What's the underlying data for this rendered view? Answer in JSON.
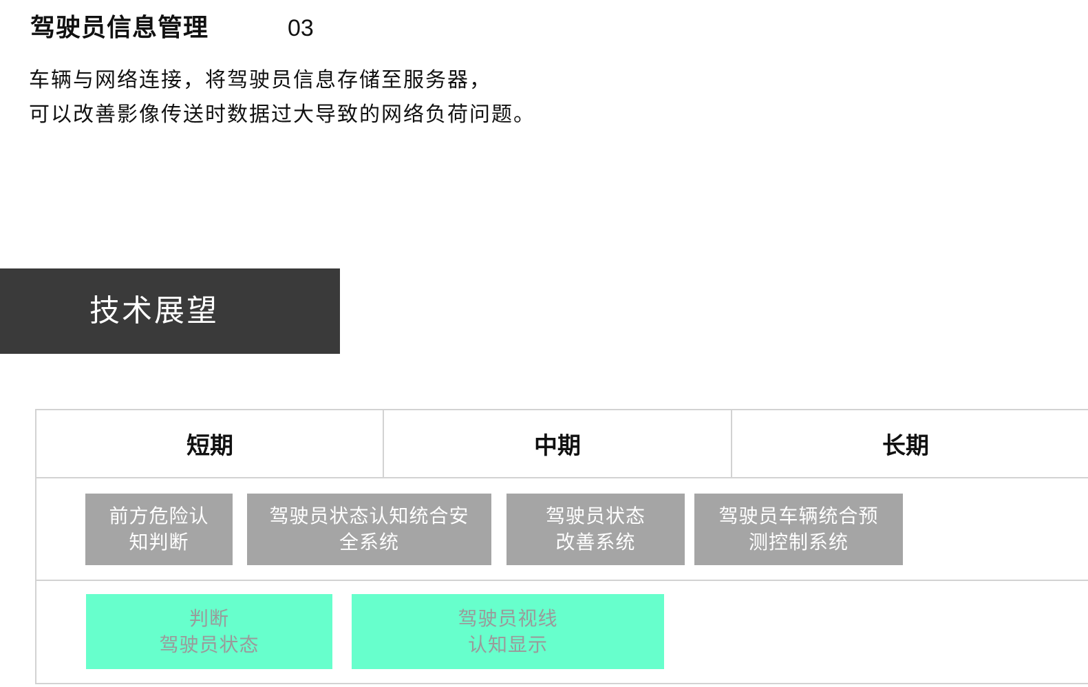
{
  "header": {
    "title": "驾驶员信息管理",
    "number": "03"
  },
  "description": {
    "line1": "车辆与网络连接，将驾驶员信息存储至服务器，",
    "line2": "可以改善影像传送时数据过大导致的网络负荷问题。"
  },
  "section": {
    "title": "技术展望"
  },
  "roadmap": {
    "phases": [
      "短期",
      "中期",
      "长期"
    ],
    "row1": [
      {
        "line1": "前方危险认",
        "line2": "知判断"
      },
      {
        "line1": "驾驶员状态认知统合安",
        "line2": "全系统"
      },
      {
        "line1": "驾驶员状态",
        "line2": "改善系统"
      },
      {
        "line1": "驾驶员车辆统合预",
        "line2": "测控制系统"
      }
    ],
    "row2": [
      {
        "line1": "判断",
        "line2": "驾驶员状态"
      },
      {
        "line1": "驾驶员视线",
        "line2": "认知显示"
      }
    ]
  },
  "colors": {
    "banner": "#3a3a3a",
    "gray_box": "#a5a5a5",
    "mint_box": "#67ffcc",
    "border": "#d2d2d2"
  }
}
